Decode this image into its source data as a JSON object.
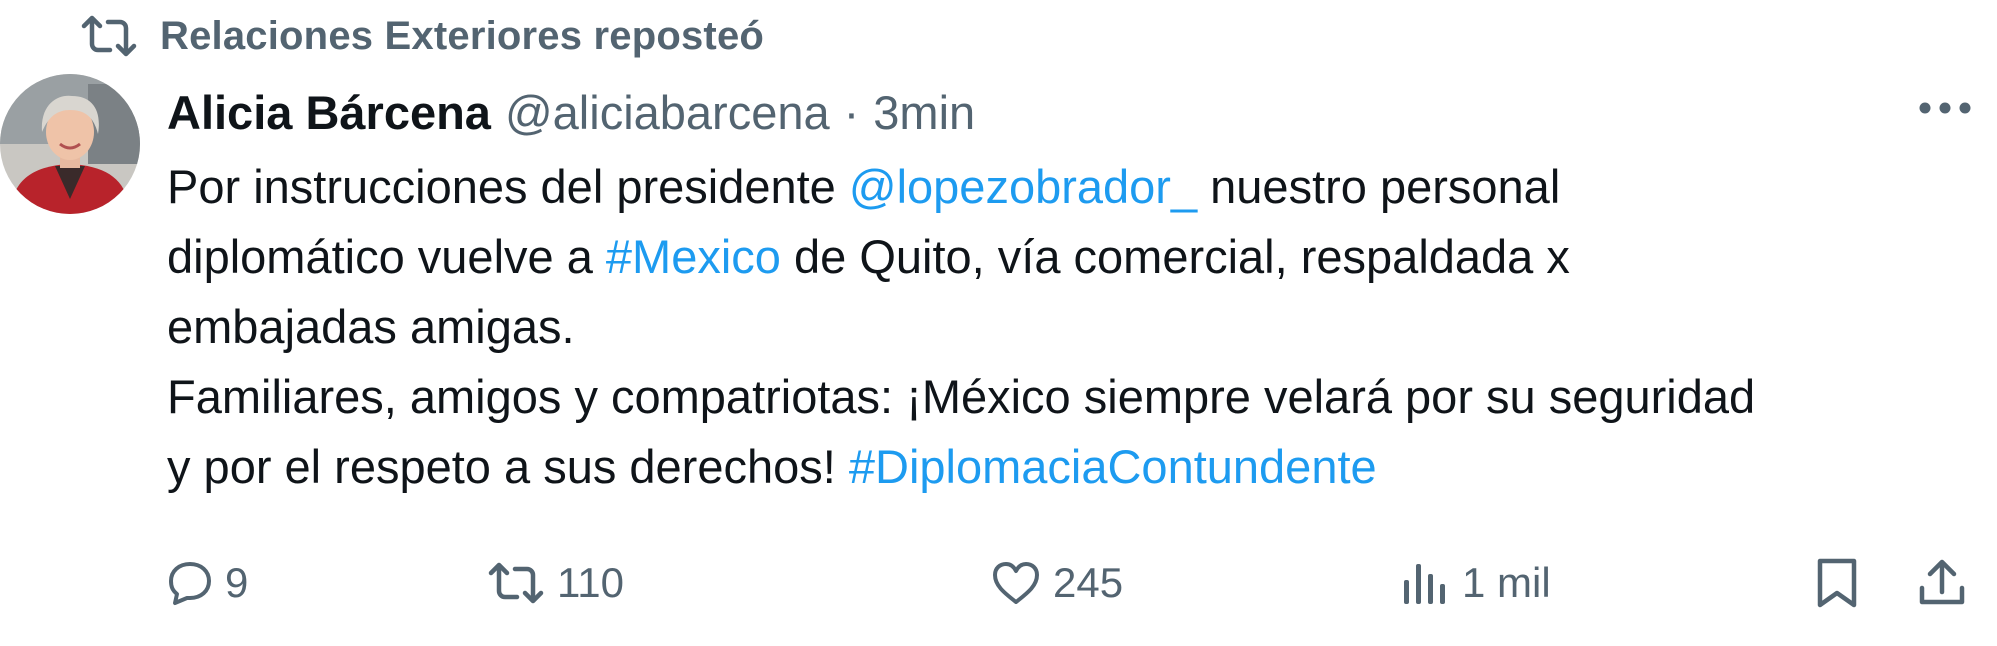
{
  "repost": {
    "icon": "repost-icon",
    "text": "Relaciones Exteriores reposteó"
  },
  "tweet": {
    "author": {
      "name": "Alicia Bárcena",
      "handle": "@aliciabarcena",
      "separator": "·",
      "time": "3min",
      "avatar": "avatar-photo"
    },
    "more_icon": "more-options-icon",
    "body": {
      "line1": {
        "pre": "Por instrucciones del presidente ",
        "mention": "@lopezobrador_",
        "post": " nuestro personal"
      },
      "line2": {
        "pre": "diplomático vuelve a ",
        "hashtag": "#Mexico",
        "post": " de Quito, vía comercial, respaldada x"
      },
      "line3": "embajadas amigas.",
      "line4": "Familiares, amigos y compatriotas: ¡México siempre velará por su seguridad",
      "line5": {
        "pre": "y por el respeto a sus derechos! ",
        "hashtag": "#DiplomaciaContundente"
      }
    },
    "actions": {
      "reply": {
        "icon": "reply-icon",
        "count": "9"
      },
      "retweet": {
        "icon": "retweet-icon",
        "count": "110"
      },
      "like": {
        "icon": "heart-icon",
        "count": "245"
      },
      "views": {
        "icon": "views-icon",
        "count": "1 mil"
      },
      "bookmark": {
        "icon": "bookmark-icon"
      },
      "share": {
        "icon": "share-icon"
      }
    },
    "colors": {
      "text": "#0f1419",
      "secondary": "#536471",
      "link": "#1d9bf0"
    }
  }
}
